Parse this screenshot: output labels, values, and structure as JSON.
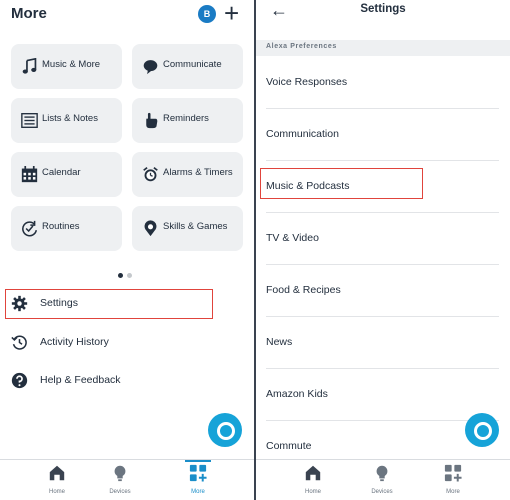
{
  "left": {
    "title": "More",
    "avatar_initial": "B",
    "tiles": [
      {
        "label": "Music & More",
        "icon": "music-note-icon"
      },
      {
        "label": "Communicate",
        "icon": "chat-bubble-icon"
      },
      {
        "label": "Lists & Notes",
        "icon": "list-icon"
      },
      {
        "label": "Reminders",
        "icon": "reminder-hand-icon"
      },
      {
        "label": "Calendar",
        "icon": "calendar-icon"
      },
      {
        "label": "Alarms & Timers",
        "icon": "alarm-clock-icon"
      },
      {
        "label": "Routines",
        "icon": "routines-check-icon"
      },
      {
        "label": "Skills & Games",
        "icon": "skills-location-icon"
      }
    ],
    "menu": [
      {
        "label": "Settings",
        "icon": "gear-icon"
      },
      {
        "label": "Activity History",
        "icon": "history-icon"
      },
      {
        "label": "Help & Feedback",
        "icon": "help-icon"
      }
    ]
  },
  "right": {
    "title": "Settings",
    "section_header": "Alexa Preferences",
    "items": [
      "Voice Responses",
      "Communication",
      "Music & Podcasts",
      "TV & Video",
      "Food & Recipes",
      "News",
      "Amazon Kids",
      "Commute"
    ]
  },
  "bottom_nav": {
    "home": "Home",
    "devices": "Devices",
    "more": "More"
  },
  "colors": {
    "accent": "#1a8ec9",
    "alexa": "#16a3d8",
    "highlight": "#e0443c",
    "tile_bg": "#eef0f2"
  }
}
